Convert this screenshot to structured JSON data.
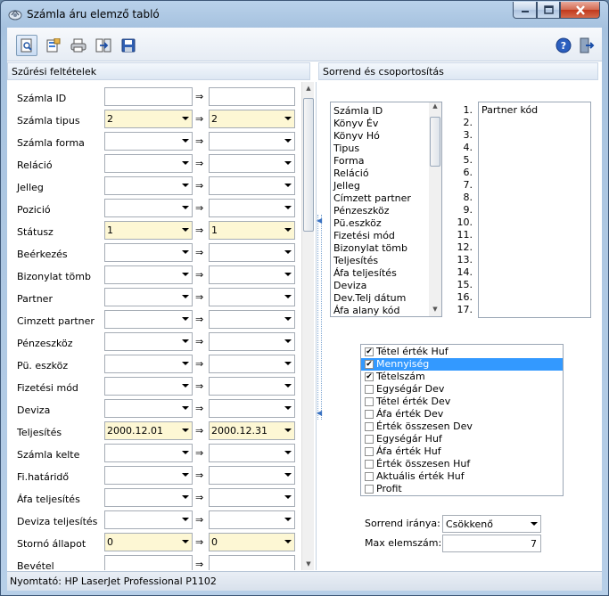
{
  "window": {
    "title": "Számla áru elemző tabló"
  },
  "toolbar": {
    "buttons": [
      "preview-icon",
      "export-icon",
      "print-icon",
      "transfer-icon",
      "save-icon"
    ],
    "right_buttons": [
      "help-icon",
      "exit-icon"
    ]
  },
  "filters": {
    "header": "Szűrési feltételek",
    "arrow": "⇒",
    "rows": [
      {
        "label": "Számla ID",
        "from": "",
        "to": "",
        "dropdown": false,
        "set": false
      },
      {
        "label": "Számla tipus",
        "from": "2",
        "to": "2",
        "dropdown": true,
        "set": true
      },
      {
        "label": "Számla forma",
        "from": "",
        "to": "",
        "dropdown": true,
        "set": false
      },
      {
        "label": "Reláció",
        "from": "",
        "to": "",
        "dropdown": true,
        "set": false
      },
      {
        "label": "Jelleg",
        "from": "",
        "to": "",
        "dropdown": true,
        "set": false
      },
      {
        "label": "Pozició",
        "from": "",
        "to": "",
        "dropdown": true,
        "set": false
      },
      {
        "label": "Státusz",
        "from": "1",
        "to": "1",
        "dropdown": true,
        "set": true
      },
      {
        "label": "Beérkezés",
        "from": "",
        "to": "",
        "dropdown": true,
        "set": false
      },
      {
        "label": "Bizonylat tömb",
        "from": "",
        "to": "",
        "dropdown": true,
        "set": false
      },
      {
        "label": "Partner",
        "from": "",
        "to": "",
        "dropdown": true,
        "set": false
      },
      {
        "label": "Cimzett partner",
        "from": "",
        "to": "",
        "dropdown": true,
        "set": false
      },
      {
        "label": "Pénzeszköz",
        "from": "",
        "to": "",
        "dropdown": true,
        "set": false
      },
      {
        "label": "Pü. eszköz",
        "from": "",
        "to": "",
        "dropdown": true,
        "set": false
      },
      {
        "label": "Fizetési mód",
        "from": "",
        "to": "",
        "dropdown": true,
        "set": false
      },
      {
        "label": "Deviza",
        "from": "",
        "to": "",
        "dropdown": true,
        "set": false
      },
      {
        "label": "Teljesítés",
        "from": "2000.12.01",
        "to": "2000.12.31",
        "dropdown": true,
        "set": true
      },
      {
        "label": "Számla kelte",
        "from": "",
        "to": "",
        "dropdown": true,
        "set": false
      },
      {
        "label": "Fi.határidő",
        "from": "",
        "to": "",
        "dropdown": true,
        "set": false
      },
      {
        "label": "Áfa teljesítés",
        "from": "",
        "to": "",
        "dropdown": true,
        "set": false
      },
      {
        "label": "Deviza teljesítés",
        "from": "",
        "to": "",
        "dropdown": true,
        "set": false
      },
      {
        "label": "Stornó állapot",
        "from": "0",
        "to": "0",
        "dropdown": true,
        "set": true
      },
      {
        "label": "Bevétel",
        "from": "",
        "to": "",
        "dropdown": false,
        "set": false
      }
    ]
  },
  "sorting": {
    "header": "Sorrend és csoportosítás",
    "available": [
      "Számla ID",
      "Könyv Év",
      "Könyv Hó",
      "Tipus",
      "Forma",
      "Reláció",
      "Jelleg",
      "Címzett partner",
      "Pénzeszköz",
      "Pü.eszköz",
      "Fizetési mód",
      "Bizonylat tömb",
      "Teljesítés",
      "Áfa teljesítés",
      "Deviza",
      "Dev.Telj dátum",
      "Áfa alany kód"
    ],
    "positions": [
      "1.",
      "2.",
      "3.",
      "4.",
      "5.",
      "6.",
      "7.",
      "8.",
      "9.",
      "10.",
      "11.",
      "12.",
      "13.",
      "14.",
      "15.",
      "16.",
      "17."
    ],
    "selected": [
      "Partner kód"
    ]
  },
  "values": {
    "items": [
      {
        "label": "Tétel érték Huf",
        "checked": true,
        "selected": false
      },
      {
        "label": "Mennyiség",
        "checked": true,
        "selected": true
      },
      {
        "label": "Tételszám",
        "checked": true,
        "selected": false
      },
      {
        "label": "Egységár Dev",
        "checked": false,
        "selected": false
      },
      {
        "label": "Tétel érték Dev",
        "checked": false,
        "selected": false
      },
      {
        "label": "Áfa érték Dev",
        "checked": false,
        "selected": false
      },
      {
        "label": "Érték összesen Dev",
        "checked": false,
        "selected": false
      },
      {
        "label": "Egységár Huf",
        "checked": false,
        "selected": false
      },
      {
        "label": "Áfa érték Huf",
        "checked": false,
        "selected": false
      },
      {
        "label": "Érték összesen Huf",
        "checked": false,
        "selected": false
      },
      {
        "label": "Aktuális érték Huf",
        "checked": false,
        "selected": false
      },
      {
        "label": "Profit",
        "checked": false,
        "selected": false
      }
    ]
  },
  "order": {
    "direction_label": "Sorrend iránya:",
    "direction_value": "Csökkenő",
    "max_label": "Max elemszám:",
    "max_value": "7"
  },
  "status": {
    "printer": "Nyomtató: HP LaserJet Professional P1102"
  }
}
